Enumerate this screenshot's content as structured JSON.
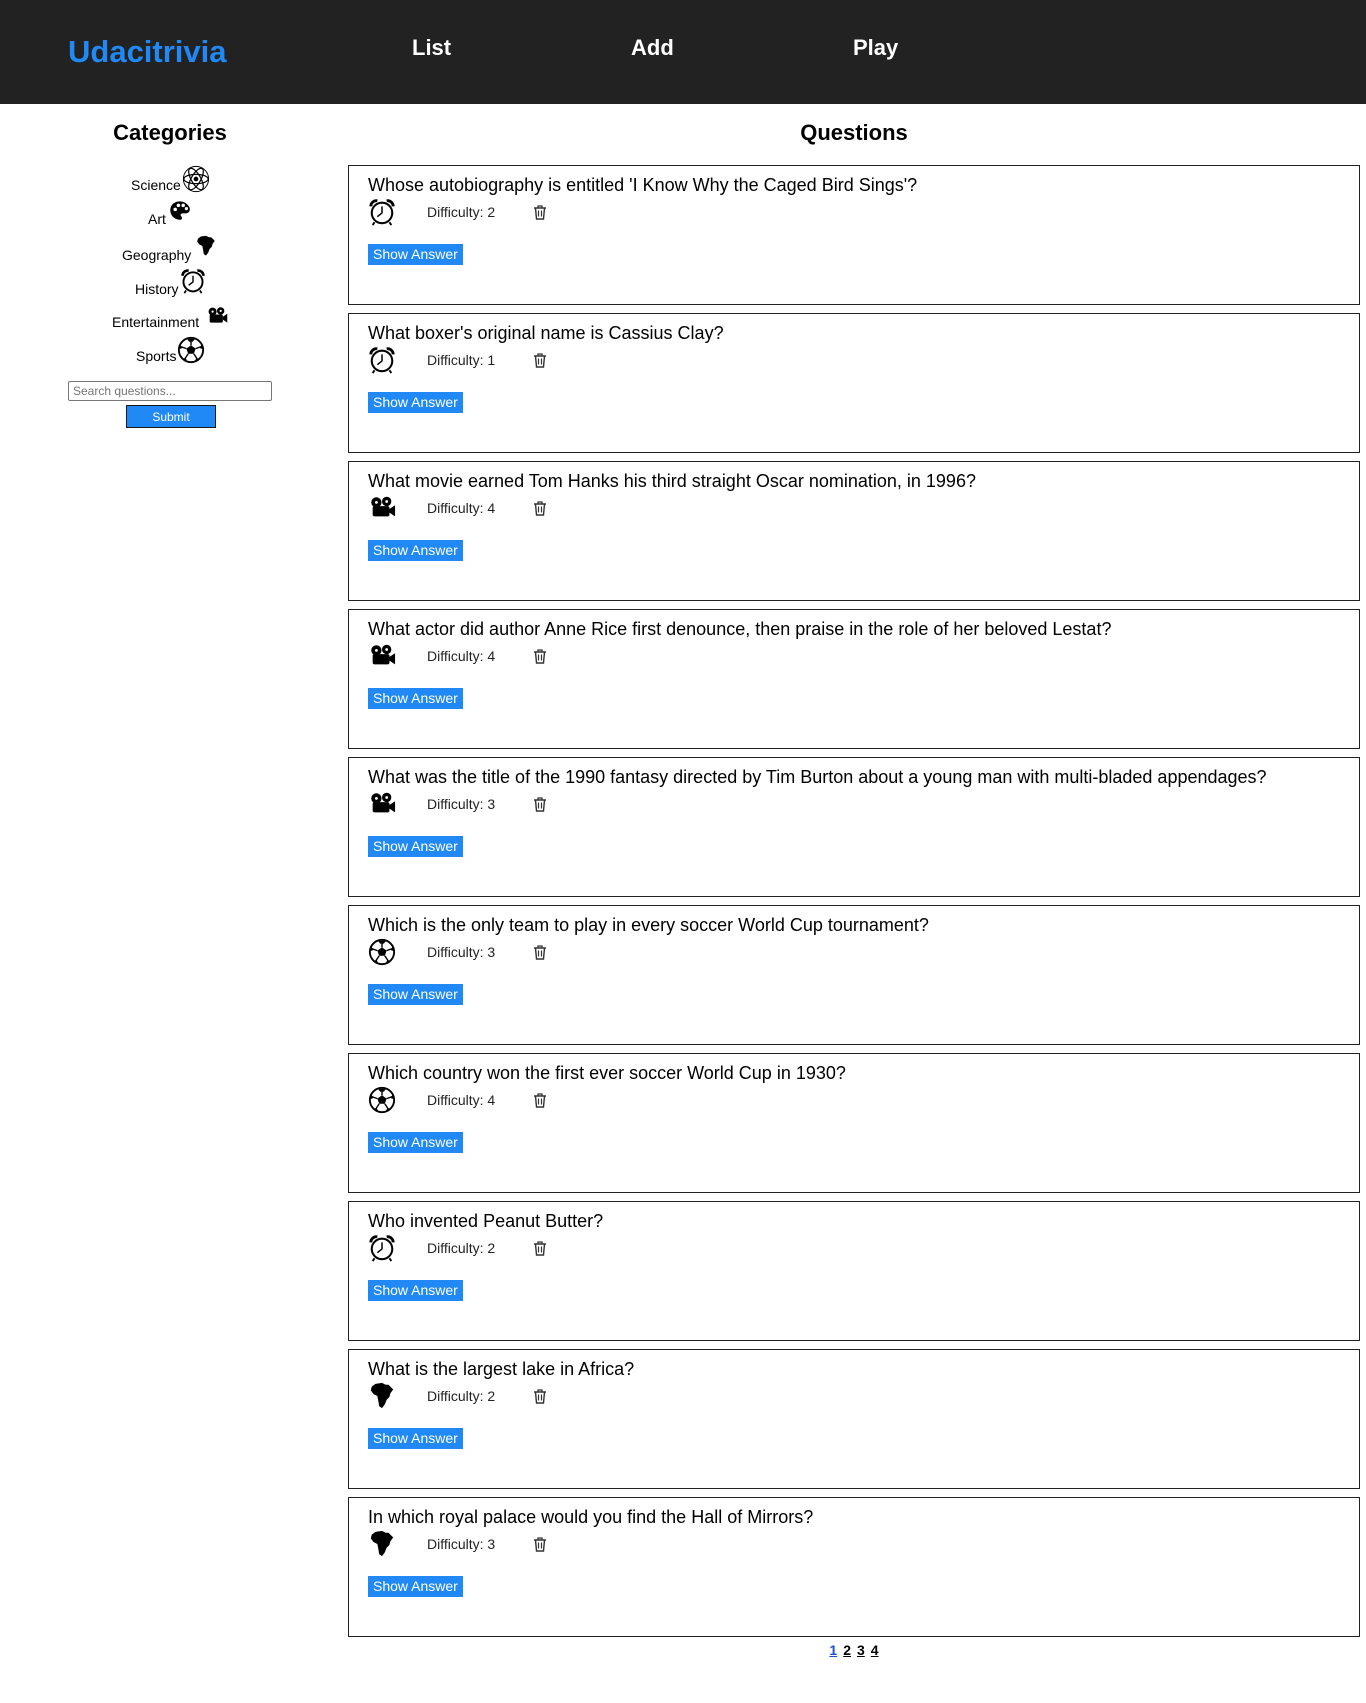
{
  "header": {
    "brand": "Udacitrivia",
    "nav": [
      "List",
      "Add",
      "Play"
    ]
  },
  "sidebar": {
    "title": "Categories",
    "categories": [
      {
        "label": "Science",
        "icon": "science-icon"
      },
      {
        "label": "Art",
        "icon": "art-icon"
      },
      {
        "label": "Geography",
        "icon": "geography-icon"
      },
      {
        "label": "History",
        "icon": "history-icon"
      },
      {
        "label": "Entertainment",
        "icon": "entertainment-icon"
      },
      {
        "label": "Sports",
        "icon": "sports-icon"
      }
    ],
    "search_placeholder": "Search questions...",
    "submit_label": "Submit"
  },
  "main": {
    "title": "Questions",
    "show_answer_label": "Show Answer",
    "questions": [
      {
        "text": "Whose autobiography is entitled 'I Know Why the Caged Bird Sings'?",
        "difficulty": "Difficulty: 2",
        "category_icon": "history-icon"
      },
      {
        "text": "What boxer's original name is Cassius Clay?",
        "difficulty": "Difficulty: 1",
        "category_icon": "history-icon"
      },
      {
        "text": "What movie earned Tom Hanks his third straight Oscar nomination, in 1996?",
        "difficulty": "Difficulty: 4",
        "category_icon": "entertainment-icon"
      },
      {
        "text": "What actor did author Anne Rice first denounce, then praise in the role of her beloved Lestat?",
        "difficulty": "Difficulty: 4",
        "category_icon": "entertainment-icon"
      },
      {
        "text": "What was the title of the 1990 fantasy directed by Tim Burton about a young man with multi-bladed appendages?",
        "difficulty": "Difficulty: 3",
        "category_icon": "entertainment-icon"
      },
      {
        "text": "Which is the only team to play in every soccer World Cup tournament?",
        "difficulty": "Difficulty: 3",
        "category_icon": "sports-icon"
      },
      {
        "text": "Which country won the first ever soccer World Cup in 1930?",
        "difficulty": "Difficulty: 4",
        "category_icon": "sports-icon"
      },
      {
        "text": "Who invented Peanut Butter?",
        "difficulty": "Difficulty: 2",
        "category_icon": "history-icon"
      },
      {
        "text": "What is the largest lake in Africa?",
        "difficulty": "Difficulty: 2",
        "category_icon": "geography-icon"
      },
      {
        "text": "In which royal palace would you find the Hall of Mirrors?",
        "difficulty": "Difficulty: 3",
        "category_icon": "geography-icon"
      }
    ]
  },
  "pagination": {
    "pages": [
      "1",
      "2",
      "3",
      "4"
    ],
    "current": "1"
  },
  "colors": {
    "header_bg": "#222222",
    "accent": "#2089f5"
  }
}
